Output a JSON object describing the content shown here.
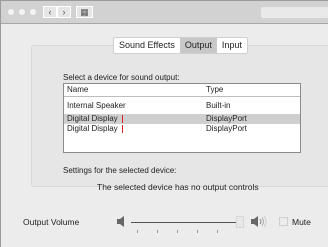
{
  "tabs": [
    {
      "label": "Sound Effects"
    },
    {
      "label": "Output"
    },
    {
      "label": "Input"
    }
  ],
  "output": {
    "prompt": "Select a device for sound output:",
    "columns": [
      "Name",
      "Type"
    ],
    "devices": [
      {
        "name": "Internal Speaker",
        "type": "Built-in",
        "selected": false
      },
      {
        "name": "Digital Display",
        "type": "DisplayPort",
        "selected": true
      },
      {
        "name": "Digital Display",
        "type": "DisplayPort",
        "selected": false
      }
    ],
    "settings_label": "Settings for the selected device:",
    "no_controls": "The selected device has no  output controls"
  },
  "volume": {
    "label": "Output Volume",
    "level": 1.0,
    "mute_label": "Mute",
    "muted": false
  },
  "colors": {
    "selection": "#cfcfcf",
    "caret": "#d9201e"
  }
}
